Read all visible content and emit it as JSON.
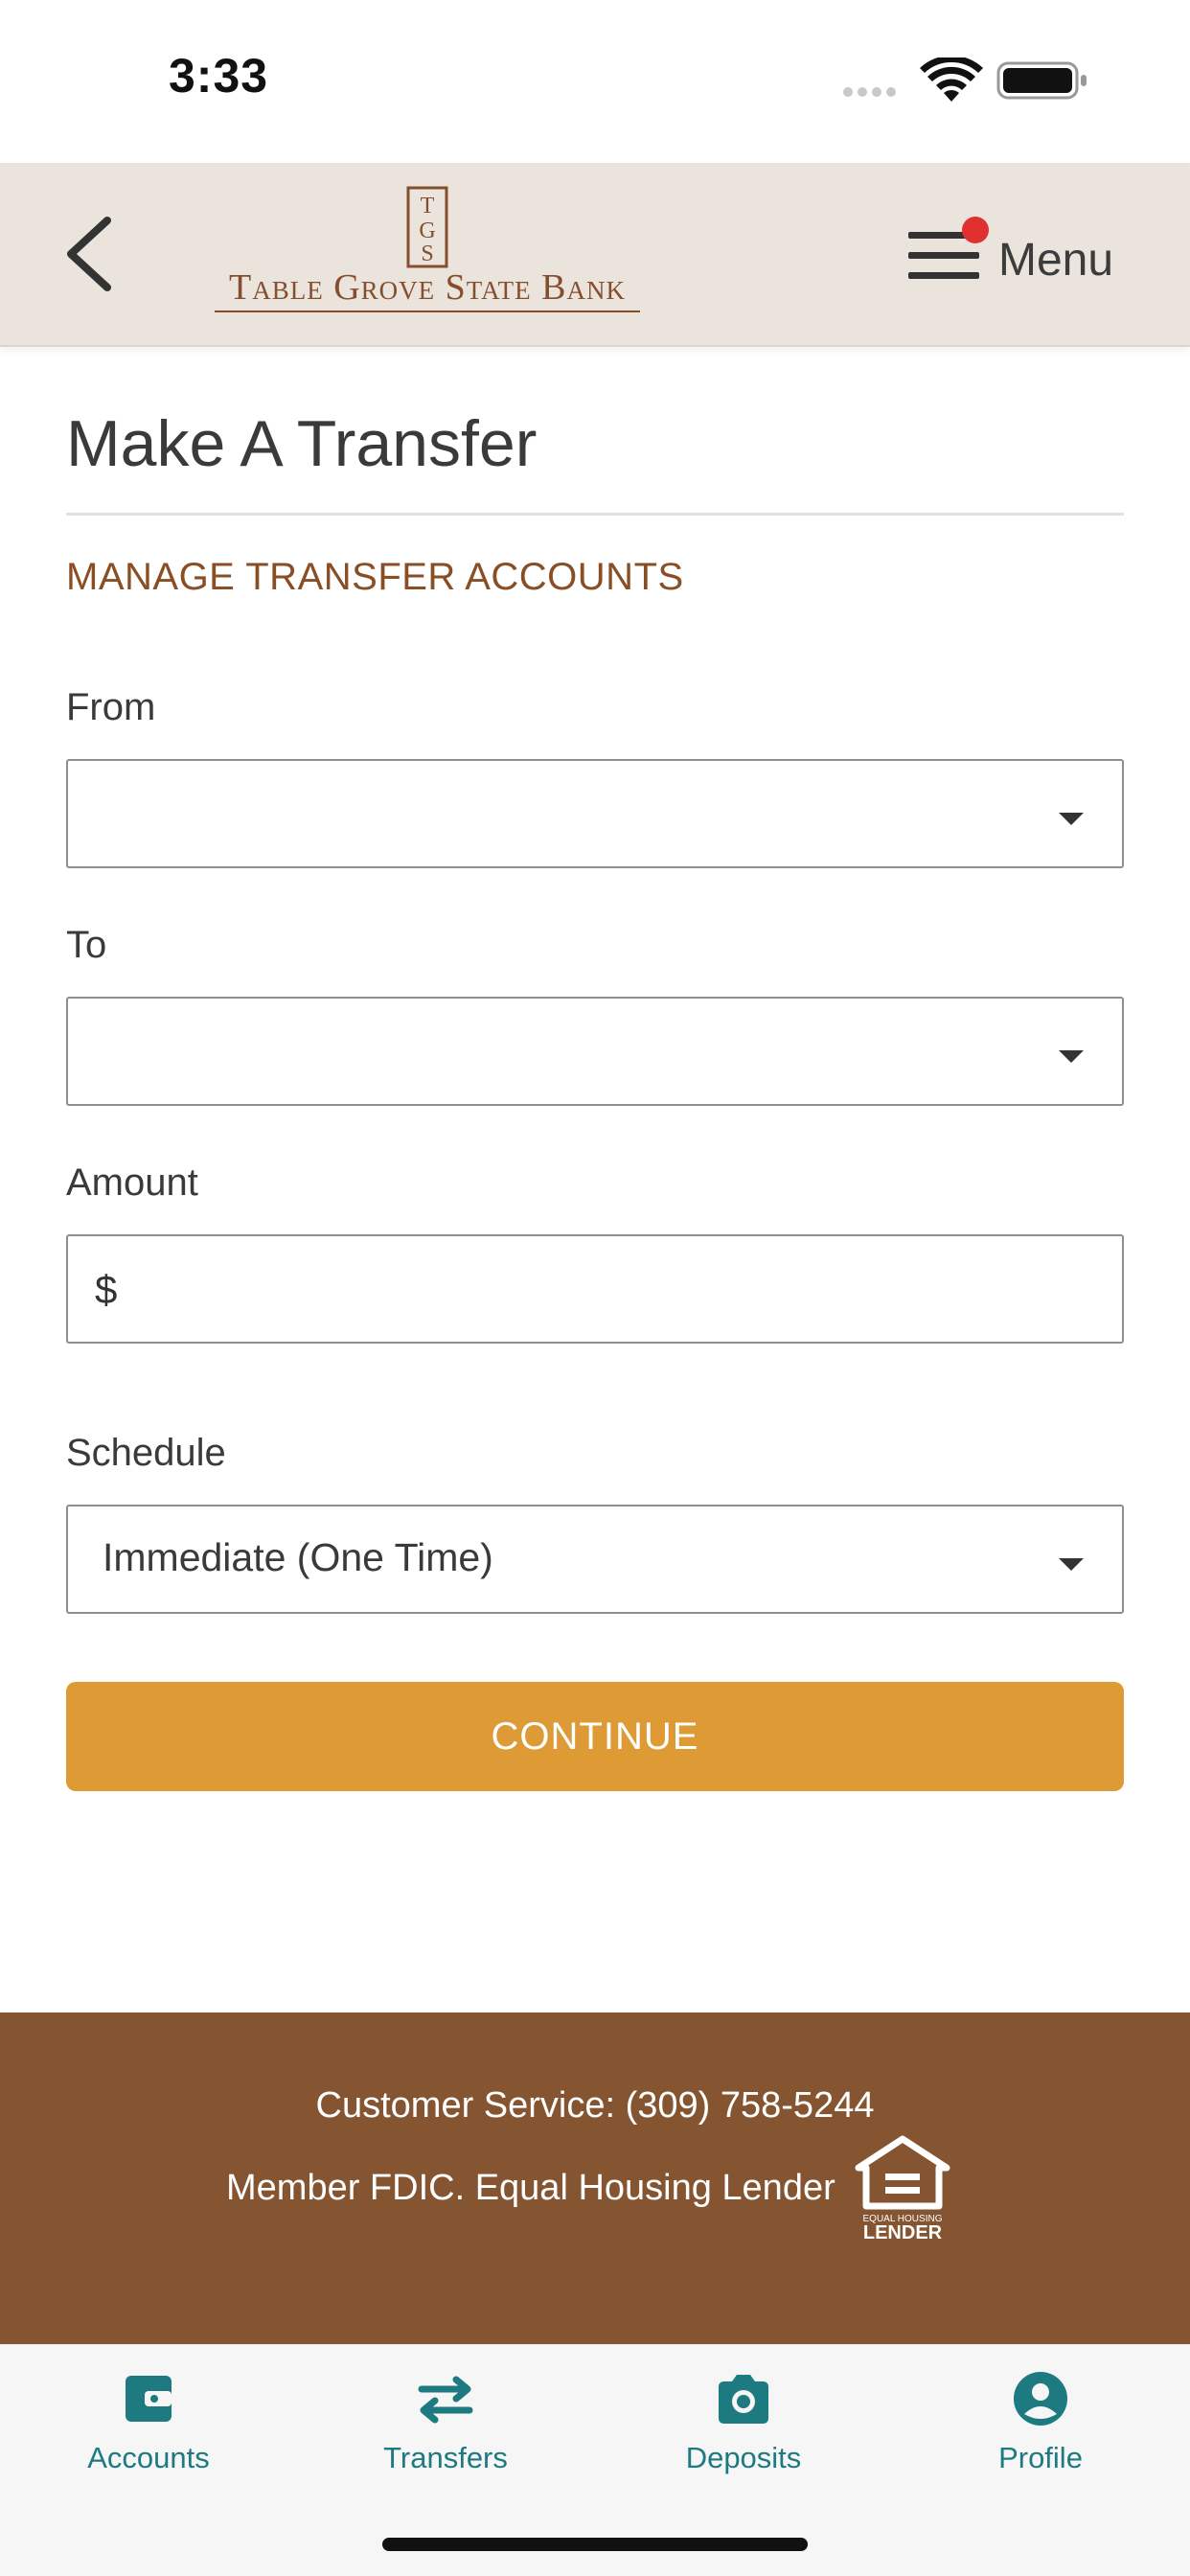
{
  "status_bar": {
    "time": "3:33"
  },
  "header": {
    "logo_text": "Table Grove State Bank",
    "menu_label": "Menu",
    "has_notification": true
  },
  "page": {
    "title": "Make A Transfer",
    "manage_link": "MANAGE TRANSFER ACCOUNTS"
  },
  "form": {
    "from": {
      "label": "From",
      "value": ""
    },
    "to": {
      "label": "To",
      "value": ""
    },
    "amount": {
      "label": "Amount",
      "prefix": "$",
      "value": ""
    },
    "schedule": {
      "label": "Schedule",
      "value": "Immediate (One Time)"
    },
    "continue_label": "CONTINUE"
  },
  "footer": {
    "customer_service": "Customer Service: (309) 758-5244",
    "member_text": "Member FDIC. Equal Housing Lender",
    "ehl_top": "EQUAL HOUSING",
    "ehl_bottom": "LENDER"
  },
  "tabs": [
    {
      "label": "Accounts",
      "icon": "wallet-icon"
    },
    {
      "label": "Transfers",
      "icon": "transfer-arrows-icon"
    },
    {
      "label": "Deposits",
      "icon": "camera-icon"
    },
    {
      "label": "Profile",
      "icon": "profile-icon"
    }
  ],
  "colors": {
    "brand_brown": "#855532",
    "header_bg": "#ebe4dd",
    "continue_button": "#dd9a35",
    "tab_accent": "#1d7a80",
    "notification": "#e03030"
  }
}
